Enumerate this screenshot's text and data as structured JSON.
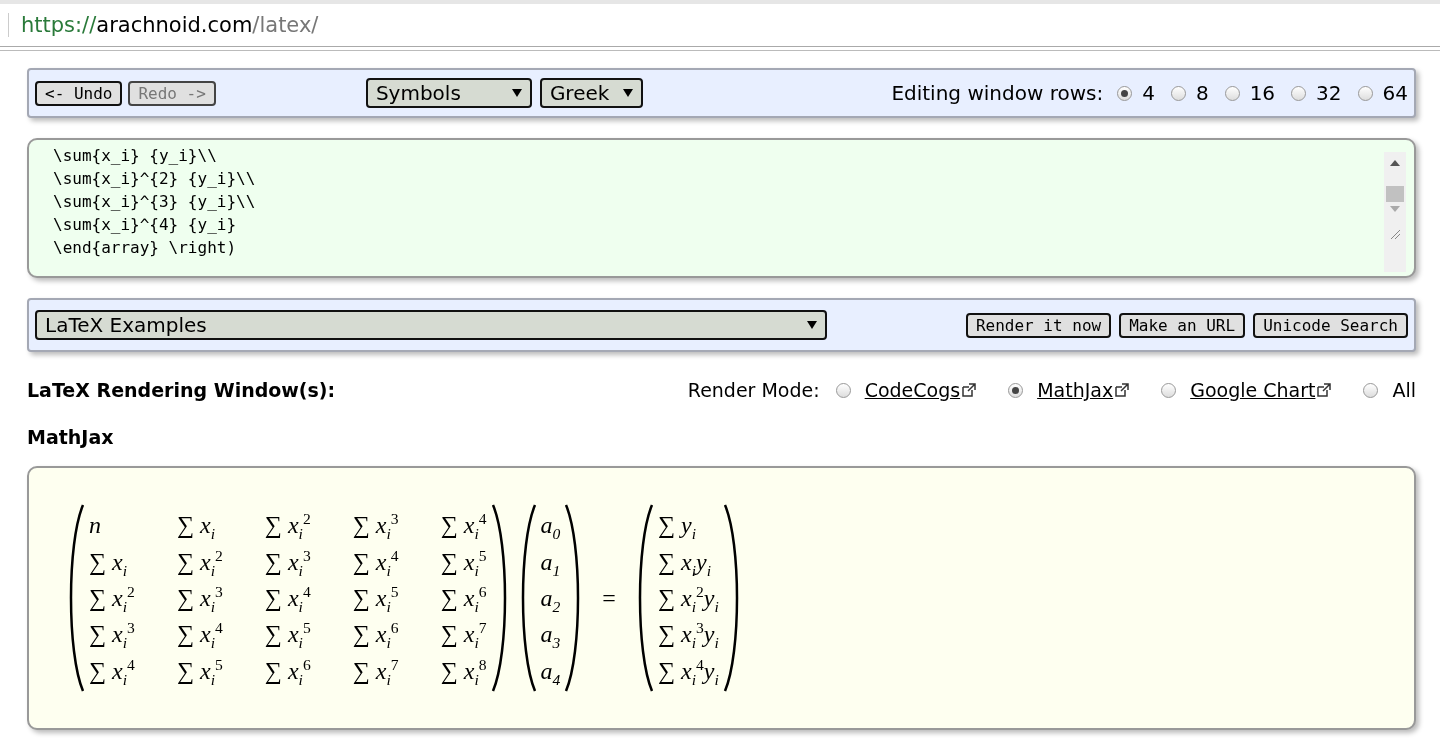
{
  "address_bar": {
    "scheme": "https://",
    "host": "arachnoid.com",
    "path": "/latex/"
  },
  "toolbar": {
    "undo": {
      "label": "<- Undo",
      "disabled": false
    },
    "redo": {
      "label": "Redo ->",
      "disabled": true
    },
    "dropdowns": [
      "Symbols",
      "Greek"
    ],
    "rows_label": "Editing window rows:",
    "rows_options": [
      {
        "label": "4",
        "selected": true
      },
      {
        "label": "8",
        "selected": false
      },
      {
        "label": "16",
        "selected": false
      },
      {
        "label": "32",
        "selected": false
      },
      {
        "label": "64",
        "selected": false
      }
    ]
  },
  "editor": {
    "lines": [
      "\\sum{x_i} {y_i}\\\\",
      "\\sum{x_i}^{2} {y_i}\\\\",
      "\\sum{x_i}^{3} {y_i}\\\\",
      "\\sum{x_i}^{4} {y_i}",
      "\\end{array} \\right)"
    ]
  },
  "examples_bar": {
    "dropdown": "LaTeX Examples",
    "buttons": [
      "Render it now",
      "Make an URL",
      "Unicode Search"
    ]
  },
  "rendering": {
    "heading": "LaTeX Rendering Window(s):",
    "mode_label": "Render Mode:",
    "modes": [
      {
        "label": "CodeCogs",
        "kind": "link",
        "selected": false
      },
      {
        "label": "MathJax",
        "kind": "link",
        "selected": true
      },
      {
        "label": "Google Chart",
        "kind": "link",
        "selected": false
      },
      {
        "label": "All",
        "kind": "plain",
        "selected": false
      }
    ]
  },
  "output": {
    "title": "MathJax",
    "matrix": [
      [
        "*n*",
        "∑ *x*$_{i}$",
        "∑ *x*$_{i}$$^{2}$",
        "∑ *x*$_{i}$$^{3}$",
        "∑ *x*$_{i}$$^{4}$"
      ],
      [
        "∑ *x*$_{i}$",
        "∑ *x*$_{i}$$^{2}$",
        "∑ *x*$_{i}$$^{3}$",
        "∑ *x*$_{i}$$^{4}$",
        "∑ *x*$_{i}$$^{5}$"
      ],
      [
        "∑ *x*$_{i}$$^{2}$",
        "∑ *x*$_{i}$$^{3}$",
        "∑ *x*$_{i}$$^{4}$",
        "∑ *x*$_{i}$$^{5}$",
        "∑ *x*$_{i}$$^{6}$"
      ],
      [
        "∑ *x*$_{i}$$^{3}$",
        "∑ *x*$_{i}$$^{4}$",
        "∑ *x*$_{i}$$^{5}$",
        "∑ *x*$_{i}$$^{6}$",
        "∑ *x*$_{i}$$^{7}$"
      ],
      [
        "∑ *x*$_{i}$$^{4}$",
        "∑ *x*$_{i}$$^{5}$",
        "∑ *x*$_{i}$$^{6}$",
        "∑ *x*$_{i}$$^{7}$",
        "∑ *x*$_{i}$$^{8}$"
      ]
    ],
    "vector": [
      "*a*$_{0}$",
      "*a*$_{1}$",
      "*a*$_{2}$",
      "*a*$_{3}$",
      "*a*$_{4}$"
    ],
    "equals": "=",
    "result": [
      "∑ *y*$_{i}$",
      "∑ *x*$_{i}$*y*$_{i}$",
      "∑ *x*$_{i}$$^{2}$*y*$_{i}$",
      "∑ *x*$_{i}$$^{3}$*y*$_{i}$",
      "∑ *x*$_{i}$$^{4}$*y*$_{i}$"
    ]
  }
}
